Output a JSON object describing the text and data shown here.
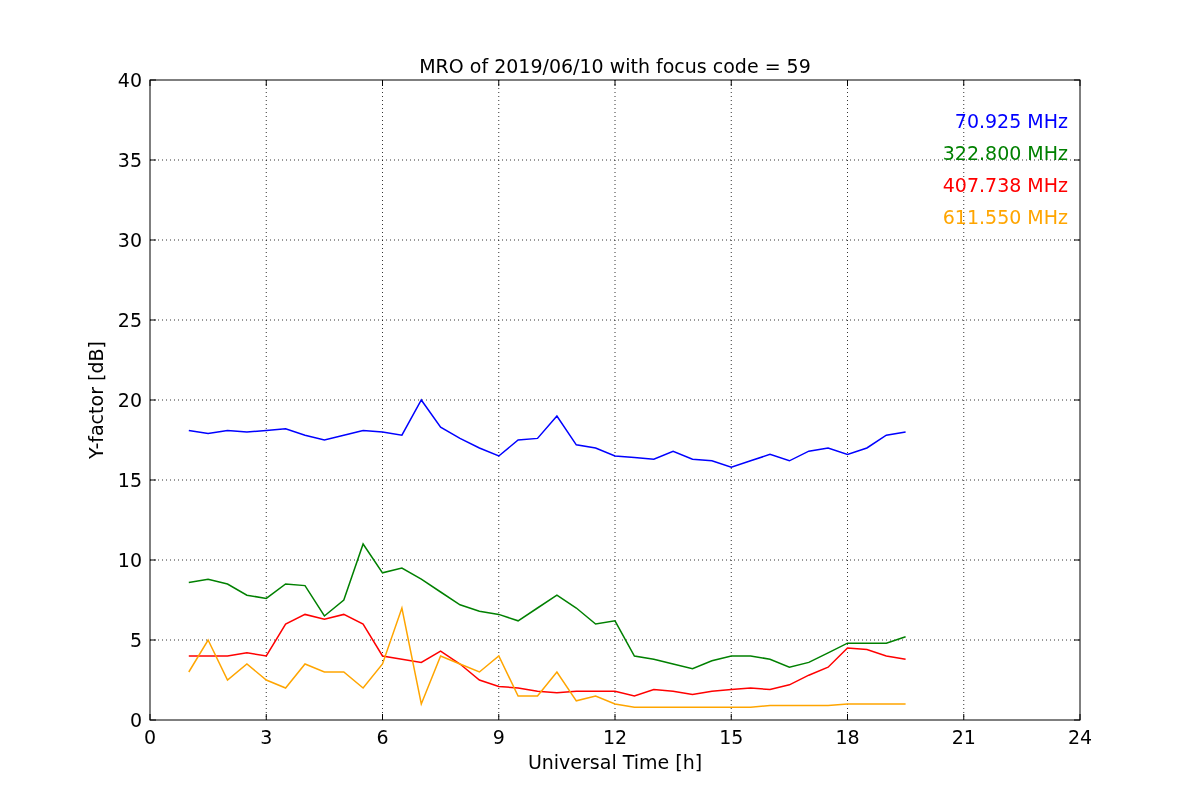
{
  "chart_data": {
    "type": "line",
    "title": "MRO of 2019/06/10 with focus code = 59",
    "xlabel": "Universal Time [h]",
    "ylabel": "Y-factor [dB]",
    "x": [
      1,
      1.5,
      2,
      2.5,
      3,
      3.5,
      4,
      4.5,
      5,
      5.5,
      6,
      6.5,
      7,
      7.5,
      8,
      8.5,
      9,
      9.5,
      10,
      10.5,
      11,
      11.5,
      12,
      12.5,
      13,
      13.5,
      14,
      14.5,
      15,
      15.5,
      16,
      16.5,
      17,
      17.5,
      18,
      18.5,
      19,
      19.5
    ],
    "series": [
      {
        "name": "70.925 MHz",
        "color": "#0000ff",
        "values": [
          18.1,
          17.9,
          18.1,
          18,
          18.1,
          18.2,
          17.8,
          17.5,
          17.8,
          18.1,
          18,
          17.8,
          20,
          18.3,
          17.6,
          17,
          16.5,
          17.5,
          17.6,
          19,
          17.2,
          17,
          16.5,
          16.4,
          16.3,
          16.8,
          16.3,
          16.2,
          15.8,
          16.2,
          16.6,
          16.2,
          16.8,
          17,
          16.6,
          17,
          17.8,
          18
        ]
      },
      {
        "name": "322.800 MHz",
        "color": "#008000",
        "values": [
          8.6,
          8.8,
          8.5,
          7.8,
          7.6,
          8.5,
          8.4,
          6.5,
          7.5,
          11,
          9.2,
          9.5,
          8.8,
          8,
          7.2,
          6.8,
          6.6,
          6.2,
          7,
          7.8,
          7,
          6,
          6.2,
          4,
          3.8,
          3.5,
          3.2,
          3.7,
          4,
          4,
          3.8,
          3.3,
          3.6,
          4.2,
          4.8,
          4.8,
          4.8,
          5.2
        ]
      },
      {
        "name": "407.738 MHz",
        "color": "#ff0000",
        "values": [
          4,
          4,
          4,
          4.2,
          4,
          6,
          6.6,
          6.3,
          6.6,
          6,
          4,
          3.8,
          3.6,
          4.3,
          3.5,
          2.5,
          2.1,
          2,
          1.8,
          1.7,
          1.8,
          1.8,
          1.8,
          1.5,
          1.9,
          1.8,
          1.6,
          1.8,
          1.9,
          2,
          1.9,
          2.2,
          2.8,
          3.3,
          4.5,
          4.4,
          4,
          3.8
        ]
      },
      {
        "name": "611.550 MHz",
        "color": "#ffa500",
        "values": [
          3,
          5,
          2.5,
          3.5,
          2.5,
          2,
          3.5,
          3,
          3,
          2,
          3.5,
          7,
          1,
          4,
          3.5,
          3,
          4,
          1.5,
          1.5,
          3,
          1.2,
          1.5,
          1,
          0.8,
          0.8,
          0.8,
          0.8,
          0.8,
          0.8,
          0.8,
          0.9,
          0.9,
          0.9,
          0.9,
          1,
          1,
          1,
          1
        ]
      }
    ],
    "xlim": [
      0,
      24
    ],
    "ylim": [
      0,
      40
    ],
    "xticks": [
      0,
      3,
      6,
      9,
      12,
      15,
      18,
      21,
      24
    ],
    "yticks": [
      0,
      5,
      10,
      15,
      20,
      25,
      30,
      35,
      40
    ],
    "grid": true
  }
}
